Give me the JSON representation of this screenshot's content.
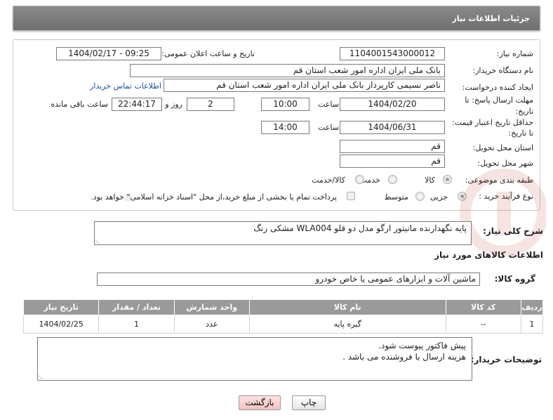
{
  "header": {
    "title": "جزئیات اطلاعات نیاز"
  },
  "form": {
    "need_number": {
      "label": "شماره نیاز:",
      "value": "1104001543000012"
    },
    "announce_datetime": {
      "label": "تاریخ و ساعت اعلان عمومی:",
      "value": "1404/02/17 - 09:25"
    },
    "buyer_org": {
      "label": "نام دستگاه خریدار:",
      "value": "بانک ملی ایران اداره امور شعب استان قم"
    },
    "requester": {
      "label": "ایجاد کننده درخواست:",
      "value": "ناصر  نسیمی  کارپرداز  بانک ملی ایران اداره امور شعب استان قم",
      "contact_link": "اطلاعات تماس خریدار"
    },
    "reply_deadline": {
      "label_line1": "مهلت ارسال پاسخ: تا",
      "label_line2": "تاریخ:",
      "date": "1404/02/20",
      "time_label": "ساعت",
      "time": "10:00",
      "days": "2",
      "days_label": "روز و",
      "remaining": "22:44:17",
      "remaining_label": "ساعت باقی مانده"
    },
    "price_validity": {
      "label_line1": "حداقل تاریخ اعتبار قیمت:",
      "label_line2": "تا تاریخ:",
      "date": "1404/06/31",
      "time_label": "ساعت",
      "time": "14:00"
    },
    "delivery_province": {
      "label": "استان محل تحویل:",
      "value": "قم"
    },
    "delivery_city": {
      "label": "شهر محل تحویل:",
      "value": "قم"
    },
    "category": {
      "label": "طبقه بندی موضوعی:",
      "options": [
        "کالا",
        "خدمت",
        "کالا/خدمت"
      ],
      "selected": "کالا"
    },
    "process_type": {
      "label": "نوع فرآیند خرید :",
      "options": [
        "جزیی",
        "متوسط"
      ],
      "selected": "جزیی",
      "payment_note": "پرداخت تمام یا بخشی از مبلغ خرید،از محل \"اسناد خزانه اسلامی\" خواهد بود."
    }
  },
  "description": {
    "label": "شرح کلی نیاز:",
    "value": "پایه نگهدارنده مانیتور ارگو  مدل دو قلو WLA004 مشکی رنگ"
  },
  "goods_section": {
    "title": "اطلاعات کالاهای مورد نیاز",
    "group_label": "گروه کالا:",
    "group_value": "ماشین آلات و ابزارهای عمومی یا خاص خودرو"
  },
  "items_table": {
    "headers": [
      "ردیف",
      "کد کالا",
      "نام کالا",
      "واحد شمارش",
      "تعداد / مقدار",
      "تاریخ نیاز"
    ],
    "rows": [
      [
        "1",
        "--",
        "گیره پایه",
        "عدد",
        "1",
        "1404/02/25"
      ]
    ]
  },
  "buyer_notes": {
    "label": "توضیحات خریدار:",
    "line1": "پیش فاکتور پیوست شود.",
    "line2": "هزینه ارسال با فروشنده می باشد ."
  },
  "buttons": {
    "print": "چاپ",
    "back": "بازگشت"
  },
  "watermark": {
    "text": "AriaTender.neT"
  },
  "colors": {
    "header_bg": "#7d7d7d",
    "table_header_bg": "#9a9a9a",
    "link": "#1d4fa0",
    "back_button": "#f3c2c2"
  }
}
